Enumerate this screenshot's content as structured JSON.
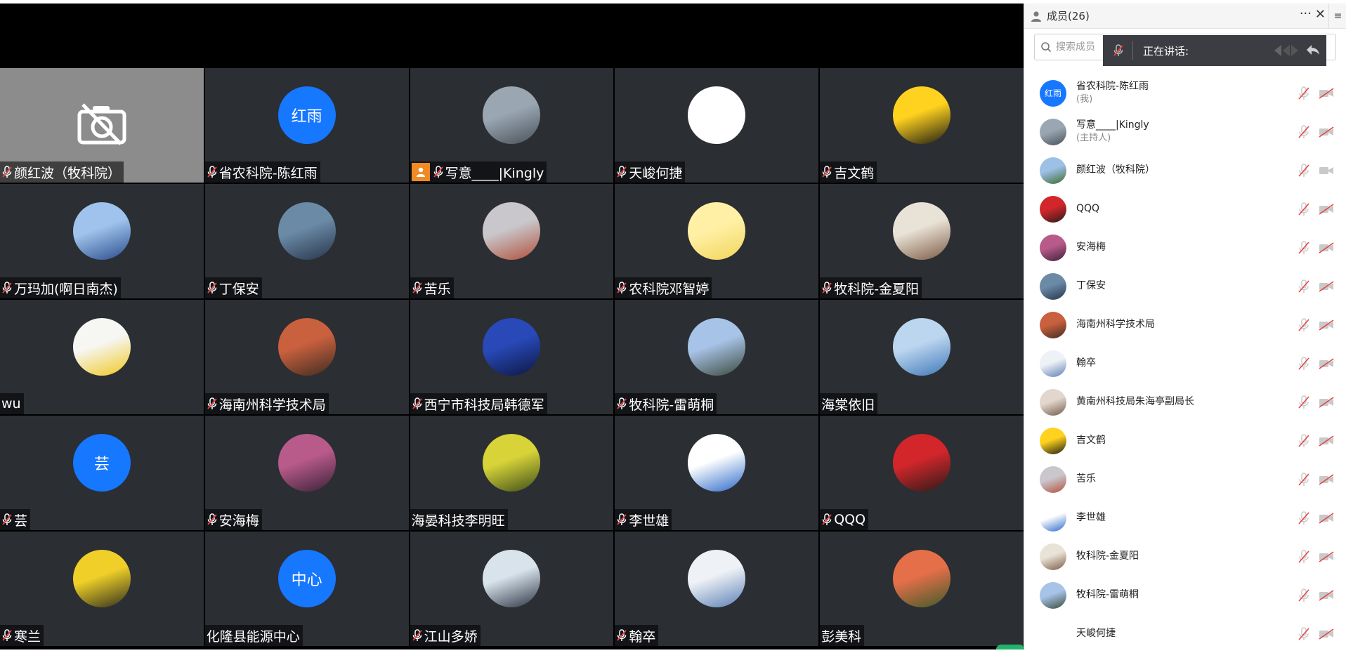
{
  "panel": {
    "title": "成员(26)",
    "more_label": "···",
    "close_label": "✕",
    "menu_label": "≡",
    "search_placeholder": "搜索成员",
    "speaking_label": "正在讲话:"
  },
  "tiles": [
    {
      "name": "颜红波（牧科院）",
      "avatar": "camera-off",
      "muted": true,
      "camoff": true
    },
    {
      "name": "省农科院-陈红雨",
      "avatar": "text",
      "avatar_text": "红雨",
      "muted": true
    },
    {
      "name": "写意____|Kingly",
      "avatar": "photo",
      "colors": [
        "#9aa7b3",
        "#4a5159"
      ],
      "muted": true,
      "host": true
    },
    {
      "name": "天峻何捷",
      "avatar": "white",
      "muted": true
    },
    {
      "name": "吉文鹤",
      "avatar": "photo",
      "colors": [
        "#ffd21f",
        "#1b1b12"
      ],
      "muted": true
    },
    {
      "name": "万玛加(啊日南杰)",
      "avatar": "photo",
      "colors": [
        "#9fc3ec",
        "#2a4c8c"
      ],
      "muted": true
    },
    {
      "name": "丁保安",
      "avatar": "photo",
      "colors": [
        "#6a8aa6",
        "#27354a"
      ],
      "muted": true
    },
    {
      "name": "苦乐",
      "avatar": "photo",
      "colors": [
        "#c9c7cc",
        "#b0503a"
      ],
      "muted": true
    },
    {
      "name": "农科院邓智婷",
      "avatar": "photo",
      "colors": [
        "#fff0a6",
        "#f1d55a"
      ],
      "muted": true
    },
    {
      "name": "牧科院-金夏阳",
      "avatar": "photo",
      "colors": [
        "#e9e2d6",
        "#7b5a43"
      ],
      "muted": true
    },
    {
      "name": "wu",
      "avatar": "photo",
      "colors": [
        "#f6f6f3",
        "#f0c81f"
      ],
      "muted": false
    },
    {
      "name": "海南州科学技术局",
      "avatar": "photo",
      "colors": [
        "#c9603e",
        "#3e2c22"
      ],
      "muted": true
    },
    {
      "name": "西宁市科技局韩德军",
      "avatar": "photo",
      "colors": [
        "#2849b7",
        "#0d1742"
      ],
      "muted": true
    },
    {
      "name": "牧科院-雷萌桐",
      "avatar": "photo",
      "colors": [
        "#a8c3e8",
        "#3a4a3c"
      ],
      "muted": true
    },
    {
      "name": "海棠依旧",
      "avatar": "photo",
      "colors": [
        "#bcd6ef",
        "#3e77b8"
      ],
      "muted": false
    },
    {
      "name": "芸",
      "avatar": "text",
      "avatar_text": "芸",
      "muted": true
    },
    {
      "name": "安海梅",
      "avatar": "photo",
      "colors": [
        "#b85a8a",
        "#3a2238"
      ],
      "muted": true
    },
    {
      "name": "海晏科技李明旺",
      "avatar": "photo",
      "colors": [
        "#d7d339",
        "#3d4d19"
      ],
      "muted": false
    },
    {
      "name": "李世雄",
      "avatar": "photo",
      "colors": [
        "#ffffff",
        "#2a68c9"
      ],
      "muted": true
    },
    {
      "name": "QQQ",
      "avatar": "photo",
      "colors": [
        "#d2262b",
        "#2b1b18"
      ],
      "muted": true
    },
    {
      "name": "寒兰",
      "avatar": "photo",
      "colors": [
        "#f0d028",
        "#2f2e1d"
      ],
      "muted": true
    },
    {
      "name": "化隆县能源中心",
      "avatar": "text",
      "avatar_text": "中心",
      "muted": false
    },
    {
      "name": "江山多娇",
      "avatar": "photo",
      "colors": [
        "#d9e3ec",
        "#2b3544"
      ],
      "muted": true
    },
    {
      "name": "翰卒",
      "avatar": "photo",
      "colors": [
        "#eef1f5",
        "#5a7fb5"
      ],
      "muted": true
    },
    {
      "name": "彭美科",
      "avatar": "photo",
      "colors": [
        "#e46f49",
        "#3f5a2a"
      ],
      "muted": false
    }
  ],
  "members": [
    {
      "name": "省农科院-陈红雨",
      "sub": "(我)",
      "avatar": "text",
      "avatar_text": "红雨",
      "cam_on": false
    },
    {
      "name": "写意____|Kingly",
      "sub": "(主持人)",
      "avatar": "photo",
      "colors": [
        "#9aa7b3",
        "#4a5159"
      ],
      "cam_on": false
    },
    {
      "name": "颜红波（牧科院）",
      "sub": "",
      "avatar": "photo",
      "colors": [
        "#9cc0e6",
        "#3c6a2d"
      ],
      "cam_on": true
    },
    {
      "name": "QQQ",
      "sub": "",
      "avatar": "photo",
      "colors": [
        "#d2262b",
        "#2b1b18"
      ],
      "cam_on": false
    },
    {
      "name": "安海梅",
      "sub": "",
      "avatar": "photo",
      "colors": [
        "#b85a8a",
        "#3a2238"
      ],
      "cam_on": false
    },
    {
      "name": "丁保安",
      "sub": "",
      "avatar": "photo",
      "colors": [
        "#6a8aa6",
        "#27354a"
      ],
      "cam_on": false
    },
    {
      "name": "海南州科学技术局",
      "sub": "",
      "avatar": "photo",
      "colors": [
        "#c9603e",
        "#3e2c22"
      ],
      "cam_on": false
    },
    {
      "name": "翰卒",
      "sub": "",
      "avatar": "photo",
      "colors": [
        "#eef1f5",
        "#5a7fb5"
      ],
      "cam_on": false
    },
    {
      "name": "黄南州科技局朱海亭副局长",
      "sub": "",
      "avatar": "photo",
      "colors": [
        "#e3d6cc",
        "#6f5a4e"
      ],
      "cam_on": false
    },
    {
      "name": "吉文鹤",
      "sub": "",
      "avatar": "photo",
      "colors": [
        "#ffd21f",
        "#1b1b12"
      ],
      "cam_on": false
    },
    {
      "name": "苦乐",
      "sub": "",
      "avatar": "photo",
      "colors": [
        "#c9c7cc",
        "#b0503a"
      ],
      "cam_on": false
    },
    {
      "name": "李世雄",
      "sub": "",
      "avatar": "photo",
      "colors": [
        "#ffffff",
        "#2a68c9"
      ],
      "cam_on": false
    },
    {
      "name": "牧科院-金夏阳",
      "sub": "",
      "avatar": "photo",
      "colors": [
        "#e9e2d6",
        "#7b5a43"
      ],
      "cam_on": false
    },
    {
      "name": "牧科院-雷萌桐",
      "sub": "",
      "avatar": "photo",
      "colors": [
        "#a8c3e8",
        "#3a4a3c"
      ],
      "cam_on": false
    },
    {
      "name": "天峻何捷",
      "sub": "",
      "avatar": "white",
      "cam_on": false
    }
  ],
  "colors": {
    "accent": "#1677ff",
    "tile_bg": "#2b2e33",
    "muted_red": "#e64545",
    "host_badge": "#f08a24"
  }
}
